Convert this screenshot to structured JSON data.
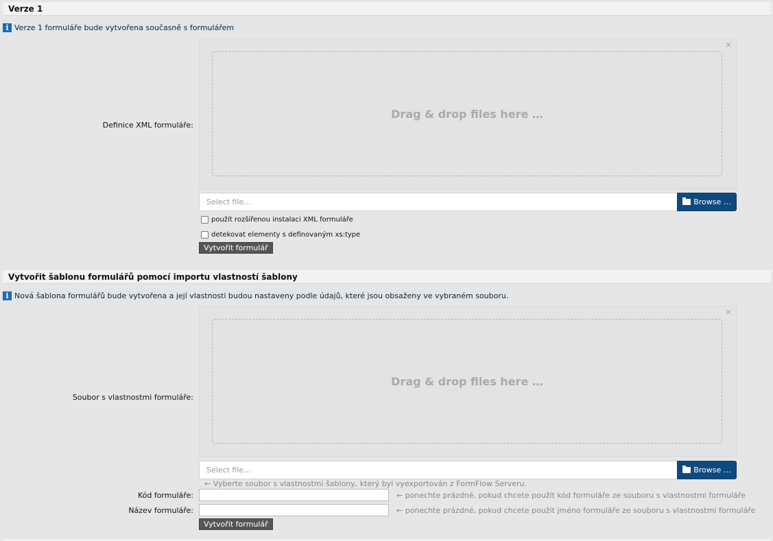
{
  "section1": {
    "title": "Verze 1",
    "info": "Verze 1 formuláře bude vytvořena současně s formulářem",
    "field_label": "Definice XML formuláře:",
    "dropzone_text": "Drag & drop files here …",
    "close": "×",
    "file_placeholder": "Select file...",
    "browse_label": "Browse …",
    "checkbox1": "použít rozšířenou instalaci XML formuláře",
    "checkbox2": "detekovat elementy s definovaným xs:type",
    "submit": "Vytvořit formulář"
  },
  "section2": {
    "title": "Vytvořit šablonu formulářů pomocí importu vlastností šablony",
    "info": "Nová šablona formulářů bude vytvořena a její vlastnosti budou nastaveny podle údajů, které jsou obsaženy ve vybraném souboru.",
    "field_label": "Soubor s vlastnostmi formuláře:",
    "dropzone_text": "Drag & drop files here …",
    "close": "×",
    "file_placeholder": "Select file...",
    "browse_label": "Browse …",
    "file_hint": "← Vyberte soubor s vlastnostmi šablony, který byl vyexportován z FormFlow Serveru.",
    "code_label": "Kód formuláře:",
    "code_hint": "← ponechte prázdné, pokud chcete použít kód formuláře ze souboru s vlastnostmi formuláře",
    "name_label": "Název formuláře:",
    "name_hint": "← ponechte prázdné, pokud chcete použít jméno formuláře ze souboru s vlastnostmi formuláře",
    "submit": "Vytvořit formulář"
  },
  "icons": {
    "info": "info-icon",
    "folder": "folder-open-icon",
    "close": "close-icon"
  }
}
